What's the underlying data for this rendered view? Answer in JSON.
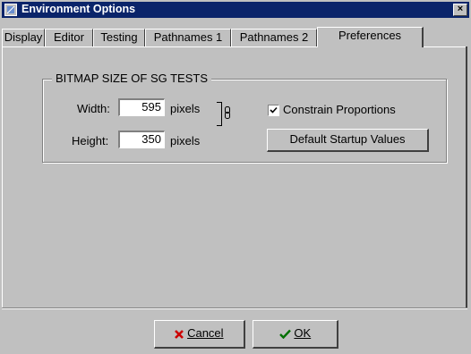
{
  "window": {
    "title": "Environment Options",
    "close_glyph": "×"
  },
  "tabs": [
    {
      "label": "Display"
    },
    {
      "label": "Editor"
    },
    {
      "label": "Testing"
    },
    {
      "label": "Pathnames 1"
    },
    {
      "label": "Pathnames 2"
    },
    {
      "label": "Preferences",
      "active": true
    }
  ],
  "bitmap_group": {
    "title": "BITMAP SIZE OF SG TESTS",
    "width_label": "Width:",
    "width_value": "595",
    "height_label": "Height:",
    "height_value": "350",
    "unit": "pixels",
    "constrain_label": "Constrain Proportions",
    "constrain_checked": true,
    "default_button": "Default Startup Values"
  },
  "buttons": {
    "cancel_label": "Cancel",
    "cancel_icon": "x-icon",
    "cancel_color": "#cc0000",
    "ok_label": "OK",
    "ok_icon": "checkmark-icon",
    "ok_color": "#007000"
  }
}
